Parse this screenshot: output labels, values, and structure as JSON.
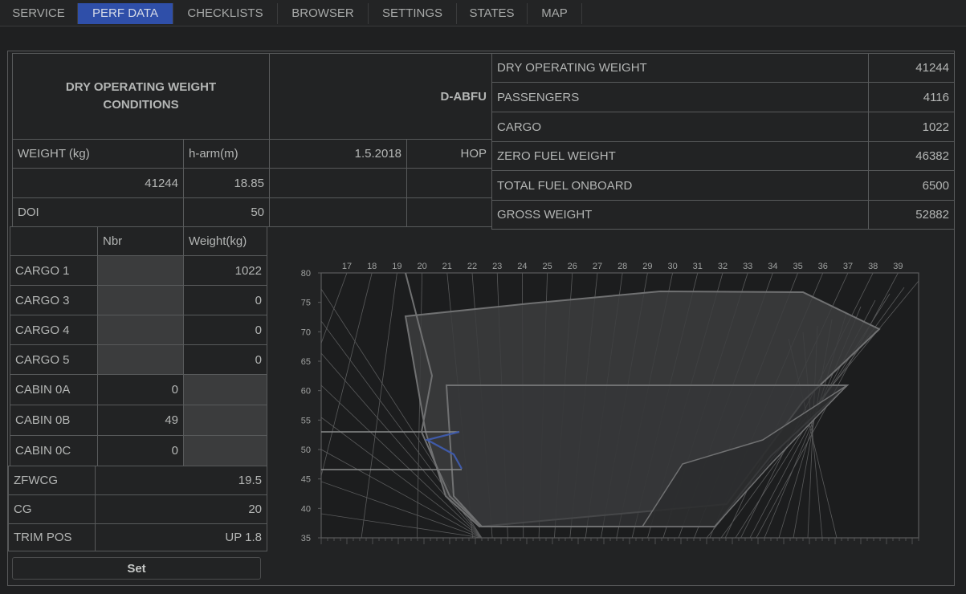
{
  "tabs": [
    {
      "label": "SERVICE",
      "active": false
    },
    {
      "label": "PERF DATA",
      "active": true
    },
    {
      "label": "CHECKLISTS",
      "active": false
    },
    {
      "label": "BROWSER",
      "active": false
    },
    {
      "label": "SETTINGS",
      "active": false
    },
    {
      "label": "STATES",
      "active": false
    },
    {
      "label": "MAP",
      "active": false
    }
  ],
  "conditions": {
    "title": "DRY OPERATING WEIGHT CONDITIONS",
    "registration": "D-ABFU",
    "weight_label": "WEIGHT (kg)",
    "harm_label": "h-arm(m)",
    "date": "1.5.2018",
    "station": "HOP",
    "weight_value": "41244",
    "harm_value": "18.85",
    "doi_label": "DOI",
    "doi_value": "50"
  },
  "summary": [
    {
      "label": "DRY OPERATING WEIGHT",
      "value": "41244"
    },
    {
      "label": "PASSENGERS",
      "value": "4116"
    },
    {
      "label": "CARGO",
      "value": "1022"
    },
    {
      "label": "ZERO FUEL WEIGHT",
      "value": "46382"
    },
    {
      "label": "TOTAL FUEL ONBOARD",
      "value": "6500"
    },
    {
      "label": "GROSS WEIGHT",
      "value": "52882"
    }
  ],
  "load": {
    "col_nbr": "Nbr",
    "col_weight": "Weight(kg)",
    "cargo": [
      {
        "label": "CARGO 1",
        "weight": "1022"
      },
      {
        "label": "CARGO 3",
        "weight": "0"
      },
      {
        "label": "CARGO 4",
        "weight": "0"
      },
      {
        "label": "CARGO 5",
        "weight": "0"
      }
    ],
    "cabin": [
      {
        "label": "CABIN 0A",
        "nbr": "0"
      },
      {
        "label": "CABIN 0B",
        "nbr": "49"
      },
      {
        "label": "CABIN 0C",
        "nbr": "0"
      }
    ]
  },
  "results": [
    {
      "label": "ZFWCG",
      "value": "19.5"
    },
    {
      "label": "CG",
      "value": "20"
    },
    {
      "label": "TRIM POS",
      "value": "UP 1.8"
    }
  ],
  "set_label": "Set",
  "chart_data": {
    "type": "line",
    "title": "",
    "xlabel": "",
    "ylabel": "",
    "x_ticks": [
      "17",
      "18",
      "19",
      "20",
      "21",
      "22",
      "23",
      "24",
      "25",
      "26",
      "27",
      "28",
      "29",
      "30",
      "31",
      "32",
      "33",
      "34",
      "35",
      "36",
      "37",
      "38",
      "39"
    ],
    "y_ticks": [
      "80",
      "75",
      "70",
      "65",
      "60",
      "55",
      "50",
      "45",
      "40",
      "35"
    ],
    "ylim": [
      35,
      80
    ],
    "grid": true,
    "colors": {
      "envelope": "#707172",
      "envelope_fill": "#3c3d3e",
      "loading_path": "#3f5aa8",
      "grid": "#5a5b5c"
    }
  }
}
